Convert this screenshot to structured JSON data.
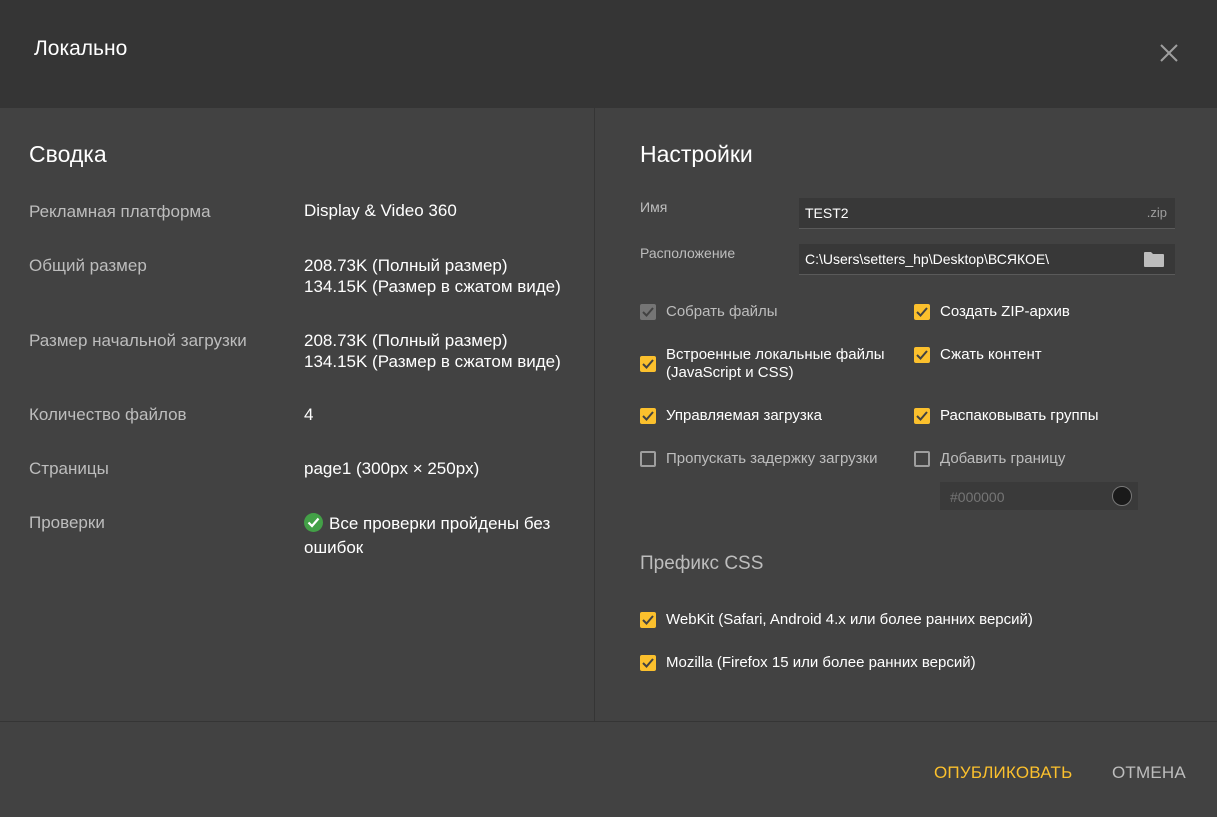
{
  "dialog": {
    "title": "Локально",
    "close_icon": "close-icon"
  },
  "summary": {
    "heading": "Сводка",
    "rows": [
      {
        "label": "Рекламная платформа",
        "value": "Display & Video 360"
      },
      {
        "label": "Общий размер",
        "value_line1": "208.73K (Полный размер)",
        "value_line2": "134.15K (Размер в сжатом виде)"
      },
      {
        "label": "Размер начальной загрузки",
        "value_line1": "208.73K (Полный размер)",
        "value_line2": "134.15K (Размер в сжатом виде)"
      },
      {
        "label": "Количество файлов",
        "value": "4"
      },
      {
        "label": "Страницы",
        "value": "page1 (300px × 250px)"
      },
      {
        "label": "Проверки",
        "value_line1": "Все проверки пройдены без",
        "value_line2": "ошибок",
        "status_icon": "check-circle-icon",
        "status_color": "#43a047"
      }
    ]
  },
  "settings": {
    "heading": "Настройки",
    "name": {
      "label": "Имя",
      "value": "TEST2",
      "suffix": ".zip"
    },
    "location": {
      "label": "Расположение",
      "value": "C:\\Users\\setters_hp\\Desktop\\ВСЯКОЕ\\",
      "icon": "folder-icon"
    },
    "options": {
      "collect_files": {
        "label": "Собрать файлы",
        "checked": true,
        "disabled": true
      },
      "create_zip": {
        "label": "Создать ZIP-архив",
        "checked": true
      },
      "inline_local_line1": "Встроенные локальные файлы",
      "inline_local_line2": "(JavaScript и CSS)",
      "inline_local_checked": true,
      "compress_content": {
        "label": "Сжать контент",
        "checked": true
      },
      "managed_loading": {
        "label": "Управляемая загрузка",
        "checked": true
      },
      "unpack_groups": {
        "label": "Распаковывать группы",
        "checked": true
      },
      "skip_load_delay": {
        "label": "Пропускать задержку загрузки",
        "checked": false
      },
      "add_border": {
        "label": "Добавить границу",
        "checked": false
      },
      "border_color": {
        "placeholder": "#000000"
      }
    },
    "css_prefix": {
      "heading": "Префикс CSS",
      "webkit": {
        "label": "WebKit (Safari, Android 4.x или более ранних версий)",
        "checked": true
      },
      "mozilla": {
        "label": "Mozilla (Firefox 15 или более ранних версий)",
        "checked": true
      }
    }
  },
  "footer": {
    "publish_label": "ОПУБЛИКОВАТЬ",
    "cancel_label": "ОТМЕНА"
  },
  "colors": {
    "accent": "#fbc02d",
    "success": "#43a047",
    "background": "#424242",
    "header": "#353535"
  }
}
